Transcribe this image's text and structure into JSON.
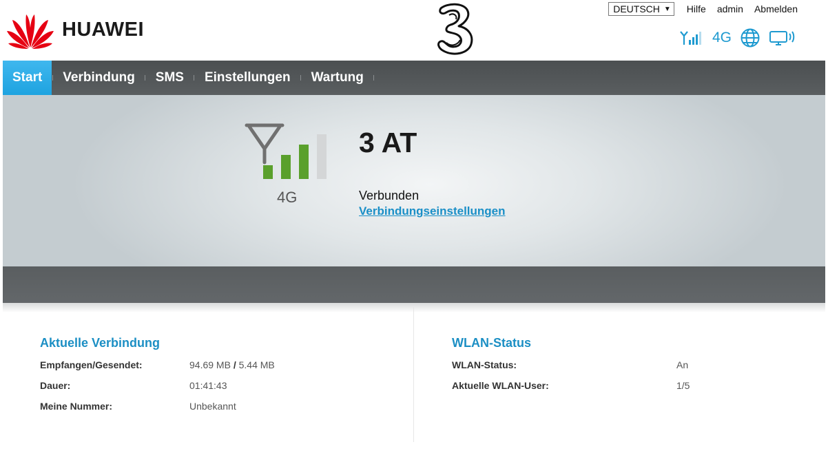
{
  "header": {
    "brand": "HUAWEI",
    "language": "DEUTSCH",
    "links": {
      "help": "Hilfe",
      "user": "admin",
      "logout": "Abmelden"
    },
    "network_badge": "4G"
  },
  "nav": {
    "items": [
      {
        "label": "Start",
        "active": true
      },
      {
        "label": "Verbindung",
        "active": false
      },
      {
        "label": "SMS",
        "active": false
      },
      {
        "label": "Einstellungen",
        "active": false
      },
      {
        "label": "Wartung",
        "active": false
      }
    ]
  },
  "banner": {
    "network_type": "4G",
    "operator": "3 AT",
    "status": "Verbunden",
    "settings_link": "Verbindungseinstellungen",
    "signal_bars": 3,
    "signal_max": 4
  },
  "connection": {
    "title": "Aktuelle Verbindung",
    "rows": [
      {
        "label": "Empfangen/Gesendet:",
        "received": "94.69 MB",
        "separator": "/",
        "sent": "5.44 MB"
      },
      {
        "label": "Dauer:",
        "value": "01:41:43"
      },
      {
        "label": "Meine Nummer:",
        "value": "Unbekannt"
      }
    ]
  },
  "wlan": {
    "title": "WLAN-Status",
    "rows": [
      {
        "label": "WLAN-Status:",
        "value": "An"
      },
      {
        "label": "Aktuelle WLAN-User:",
        "value": "1/5"
      }
    ]
  },
  "colors": {
    "accent": "#1ea3e0",
    "link": "#1a8fc7",
    "signal_green": "#5aa02c",
    "huawei_red": "#e60012",
    "nav_bg": "#4b4f51"
  }
}
